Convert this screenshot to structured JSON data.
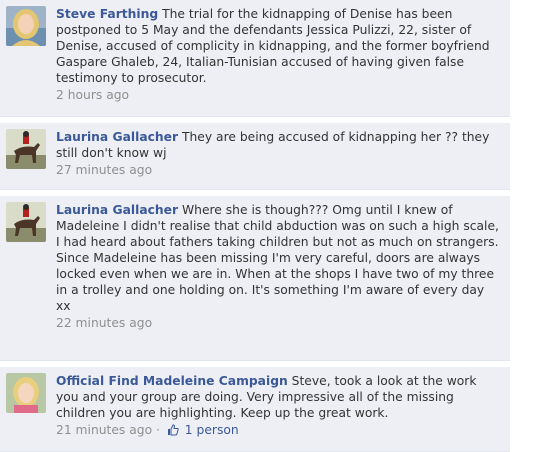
{
  "comments": [
    {
      "author": "Steve Farthing",
      "text": "The trial for the kidnapping of Denise has been postponed to 5 May and the defendants Jessica Pulizzi, 22, sister of Denise, accused of complicity in kidnapping, and the former boyfriend Gaspare Ghaleb, 24, Italian-Tunisian accused of having given false testimony to prosecutor.",
      "timestamp": "2 hours ago",
      "avatar_icon": "blonde-woman-portrait"
    },
    {
      "author": "Laurina Gallacher",
      "text": "They are being accused of kidnapping her ?? they still don't know wj",
      "timestamp": "27 minutes ago",
      "avatar_icon": "horse-rider-photo"
    },
    {
      "author": "Laurina Gallacher",
      "text": "Where she is though??? Omg until I knew of Madeleine I didn't realise that child abduction was on such a high scale, I had heard about fathers taking children but not as much on strangers. Since Madeleine has been missing I'm very careful, doors are always locked even when we are in. When at the shops I have two of my three in a trolley and one holding on. It's something I'm aware of every day xx",
      "timestamp": "22 minutes ago",
      "avatar_icon": "horse-rider-photo"
    },
    {
      "author": "Official Find Madeleine Campaign",
      "text": "Steve, took a look at the work you and your group are doing. Very impressive all of the missing children you are highlighting. Keep up the great work.",
      "timestamp": "21 minutes ago",
      "separator": "·",
      "likes_label": "1 person",
      "avatar_icon": "blonde-child-portrait"
    }
  ],
  "colors": {
    "comment_bg": "#edeff4",
    "link": "#3b5998",
    "meta": "#8f8f8f"
  }
}
